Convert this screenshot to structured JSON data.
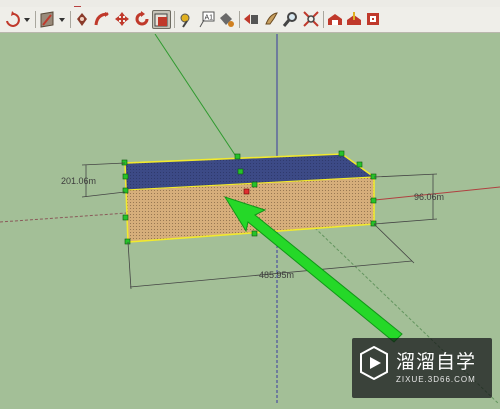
{
  "toolbar": {
    "buttons": [
      {
        "name": "orbit-tool-button",
        "icon": "orbit-icon"
      },
      {
        "name": "style-dropdown-button",
        "icon": "chevron-down-icon"
      },
      {
        "name": "section-plane-button",
        "icon": "section-plane-icon"
      },
      {
        "name": "section-dropdown-button",
        "icon": "chevron-down-icon"
      },
      {
        "name": "add-location-button",
        "icon": "location-pin-icon"
      },
      {
        "name": "follow-me-button",
        "icon": "follow-me-icon"
      },
      {
        "name": "move-tool-button",
        "icon": "move-icon"
      },
      {
        "name": "rotate-tool-button",
        "icon": "rotate-icon"
      },
      {
        "name": "scale-tool-button",
        "icon": "scale-icon",
        "active": true
      },
      {
        "name": "tape-measure-button",
        "icon": "tape-measure-icon"
      },
      {
        "name": "text-tool-button",
        "icon": "text-icon"
      },
      {
        "name": "paint-bucket-button",
        "icon": "paint-bucket-icon"
      },
      {
        "name": "component-browser-button",
        "icon": "component-icon"
      },
      {
        "name": "walk-tool-button",
        "icon": "walk-icon"
      },
      {
        "name": "zoom-tool-button",
        "icon": "zoom-icon"
      },
      {
        "name": "zoom-extents-button",
        "icon": "zoom-extents-icon"
      },
      {
        "name": "get-models-button",
        "icon": "warehouse-icon"
      },
      {
        "name": "share-model-button",
        "icon": "share-icon"
      },
      {
        "name": "extension-warehouse-button",
        "icon": "extension-icon"
      }
    ],
    "accent": "#c0392b"
  },
  "viewport": {
    "background": "#a3bf97",
    "dimensions": {
      "depth": "201.06m",
      "height": "96.06m",
      "width": "485.95m"
    },
    "box_top_color": "#3c4a86",
    "box_front_color": "#d6ae7b",
    "selection_color": "#f2ea2e",
    "arrow_color": "#25d828"
  },
  "watermark": {
    "brand": "溜溜自学",
    "url": "ZIXUE.3D66.COM"
  }
}
